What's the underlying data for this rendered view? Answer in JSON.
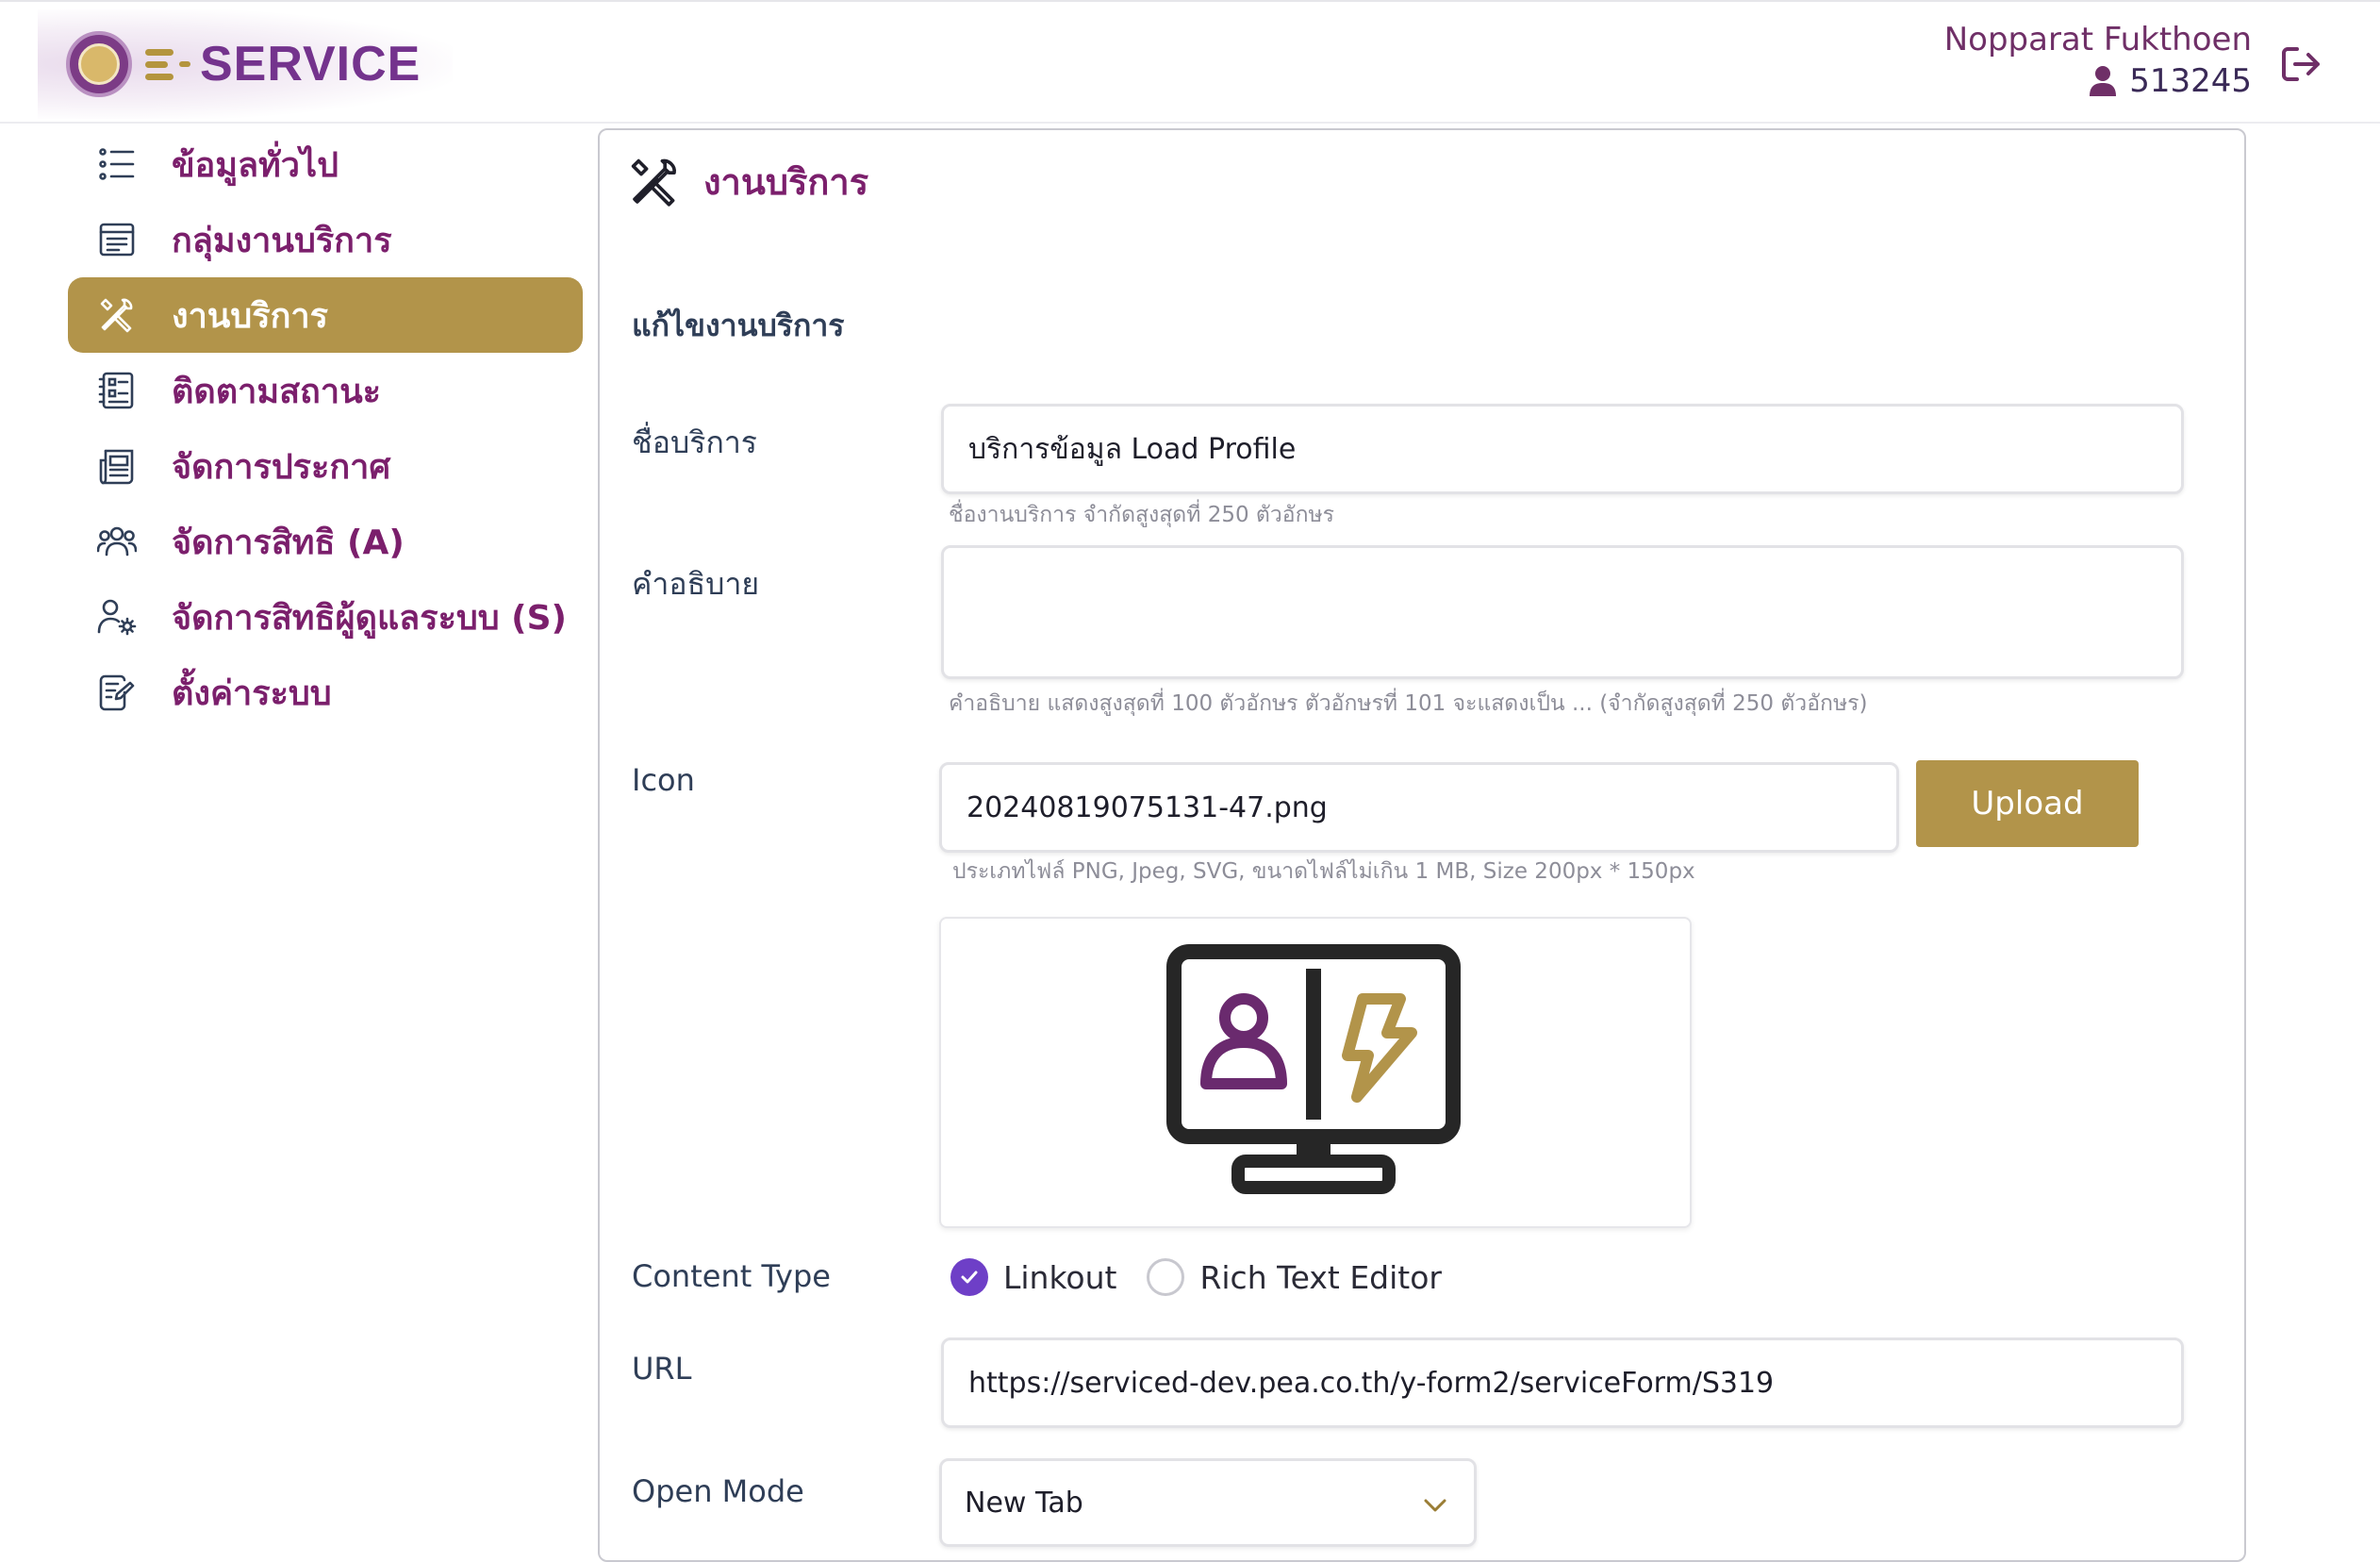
{
  "header": {
    "logo_text": "SERVICE",
    "user_name": "Nopparat Fukthoen",
    "user_id": "513245"
  },
  "sidebar": {
    "items": [
      {
        "label": "ข้อมูลทั่วไป",
        "icon": "list-icon",
        "active": false
      },
      {
        "label": "กลุ่มงานบริการ",
        "icon": "document-list-icon",
        "active": false
      },
      {
        "label": "งานบริการ",
        "icon": "tools-icon",
        "active": true
      },
      {
        "label": "ติดตามสถานะ",
        "icon": "tracking-icon",
        "active": false
      },
      {
        "label": "จัดการประกาศ",
        "icon": "newspaper-icon",
        "active": false
      },
      {
        "label": "จัดการสิทธิ (A)",
        "icon": "users-icon",
        "active": false
      },
      {
        "label": "จัดการสิทธิผู้ดูแลระบบ (S)",
        "icon": "user-gear-icon",
        "active": false
      },
      {
        "label": "ตั้งค่าระบบ",
        "icon": "edit-document-icon",
        "active": false
      }
    ]
  },
  "main": {
    "title": "งานบริการ",
    "section_title": "แก้ไขงานบริการ",
    "fields": {
      "name": {
        "label": "ชื่อบริการ",
        "value": "บริการข้อมูล Load Profile",
        "hint": "ชื่องานบริการ จำกัดสูงสุดที่ 250 ตัวอักษร"
      },
      "description": {
        "label": "คำอธิบาย",
        "value": "",
        "hint": "คำอธิบาย แสดงสูงสุดที่ 100 ตัวอักษร ตัวอักษรที่ 101 จะแสดงเป็น ... (จำกัดสูงสุดที่ 250 ตัวอักษร)"
      },
      "icon": {
        "label": "Icon",
        "value": "20240819075131-47.png",
        "hint": "ประเภทไฟล์ PNG, Jpeg, SVG, ขนาดไฟล์ไม่เกิน 1 MB, Size 200px * 150px",
        "upload_label": "Upload"
      },
      "content_type": {
        "label": "Content Type",
        "options": [
          "Linkout",
          "Rich Text Editor"
        ],
        "selected": "Linkout"
      },
      "url": {
        "label": "URL",
        "value": "https://serviced-dev.pea.co.th/y-form2/serviceForm/S319"
      },
      "open_mode": {
        "label": "Open Mode",
        "value": "New Tab"
      }
    }
  },
  "colors": {
    "brand_purple": "#7b1f6c",
    "brand_gold": "#b2944a",
    "radio_checked": "#6e3fc7"
  }
}
